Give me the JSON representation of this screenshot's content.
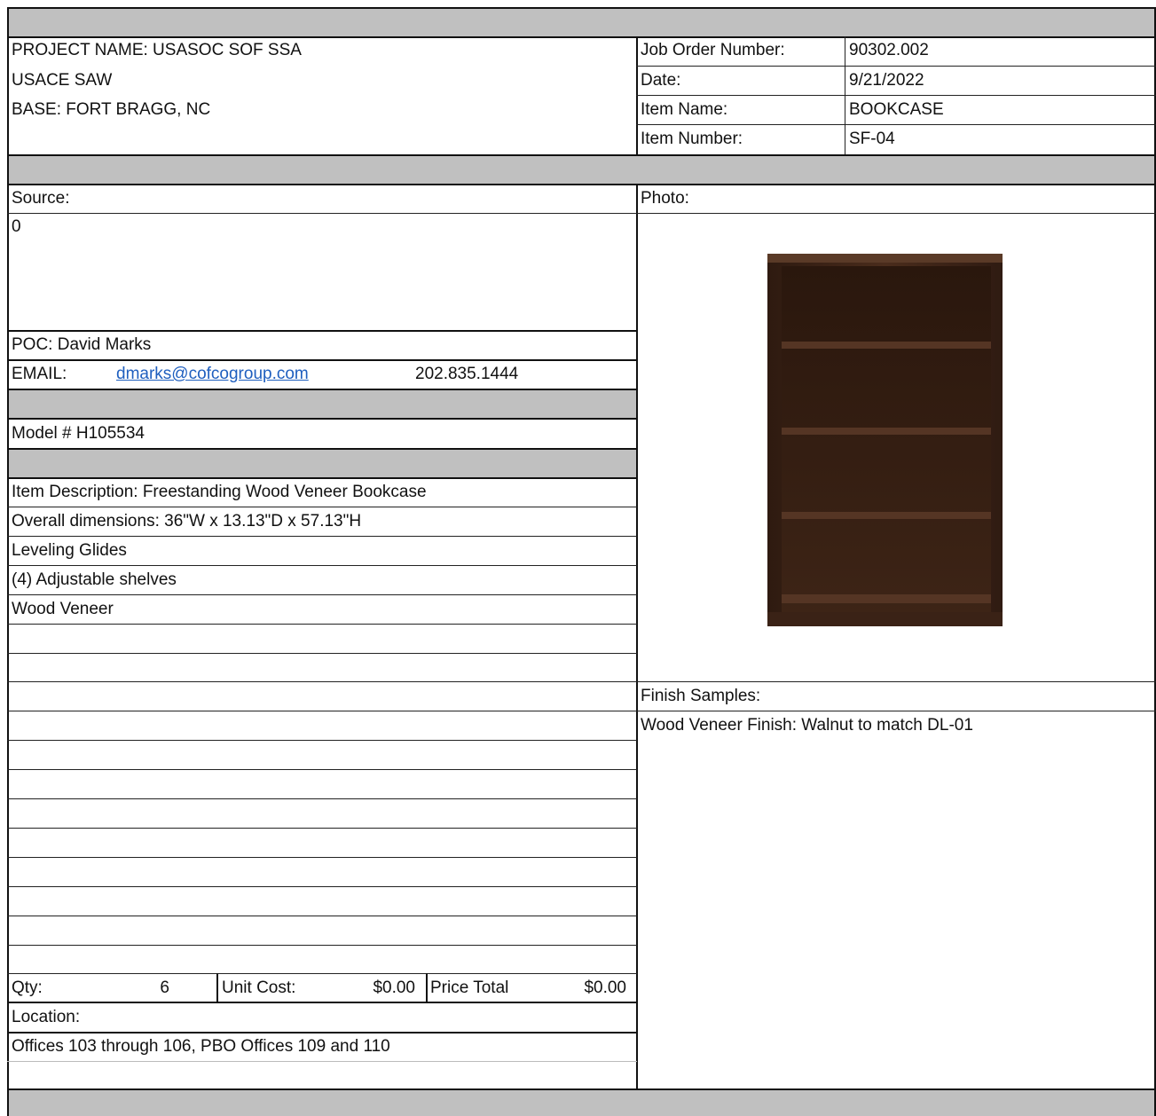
{
  "header": {
    "project_name": "PROJECT NAME: USASOC SOF SSA",
    "usace": "USACE SAW",
    "base": "BASE: FORT BRAGG, NC"
  },
  "job_info": {
    "job_order_label": "Job Order Number:",
    "job_order_value": "90302.002",
    "date_label": "Date:",
    "date_value": "9/21/2022",
    "item_name_label": "Item Name:",
    "item_name_value": "BOOKCASE",
    "item_number_label": "Item Number:",
    "item_number_value": "SF-04"
  },
  "source": {
    "label": "Source:",
    "value": "0",
    "poc": "POC: David Marks",
    "email_label": "EMAIL:",
    "email": "dmarks@cofcogroup.com",
    "phone": "202.835.1444"
  },
  "model": "Model # H105534",
  "description": {
    "lines": [
      "Item Description: Freestanding Wood Veneer Bookcase",
      "Overall dimensions: 36\"W x 13.13\"D x 57.13\"H",
      "Leveling Glides",
      "(4) Adjustable shelves",
      "Wood Veneer"
    ]
  },
  "pricing": {
    "qty_label": "Qty:",
    "qty_value": "6",
    "unit_cost_label": "Unit Cost:",
    "unit_cost_value": "$0.00",
    "price_total_label": "Price Total",
    "price_total_value": "$0.00"
  },
  "location": {
    "label": "Location:",
    "value": "Offices 103 through 106, PBO Offices 109 and 110"
  },
  "photo": {
    "label": "Photo:",
    "image_icon": "bookcase-image",
    "wood_color": "#3b2418"
  },
  "finish": {
    "label": "Finish Samples:",
    "value": "Wood Veneer Finish: Walnut to match DL-01"
  }
}
